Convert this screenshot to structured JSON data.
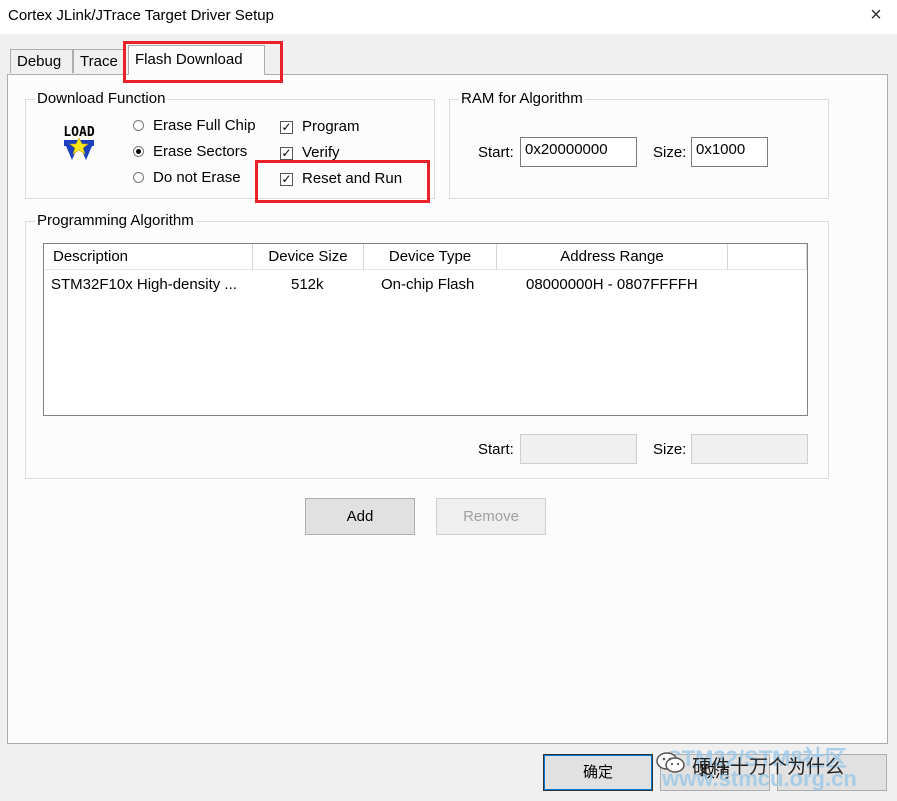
{
  "window": {
    "title": "Cortex JLink/JTrace Target Driver Setup",
    "close_glyph": "×"
  },
  "tabs": [
    {
      "label": "Debug"
    },
    {
      "label": "Trace"
    },
    {
      "label": "Flash Download",
      "selected": true
    }
  ],
  "download_function": {
    "label": "Download Function",
    "icon_text": "LOAD",
    "erase_options": [
      {
        "label": "Erase Full Chip",
        "selected": false
      },
      {
        "label": "Erase Sectors",
        "selected": true
      },
      {
        "label": "Do not Erase",
        "selected": false
      }
    ],
    "checks": [
      {
        "label": "Program",
        "checked": true
      },
      {
        "label": "Verify",
        "checked": true
      },
      {
        "label": "Reset and Run",
        "checked": true
      }
    ]
  },
  "ram_for_algorithm": {
    "label": "RAM for Algorithm",
    "start_label": "Start:",
    "start_value": "0x20000000",
    "size_label": "Size:",
    "size_value": "0x1000"
  },
  "programming_algorithm": {
    "label": "Programming Algorithm",
    "columns": [
      "Description",
      "Device Size",
      "Device Type",
      "Address Range"
    ],
    "rows": [
      [
        "STM32F10x High-density ...",
        "512k",
        "On-chip Flash",
        "08000000H - 0807FFFFH"
      ]
    ],
    "start_label": "Start:",
    "start_value": "",
    "size_label": "Size:",
    "size_value": ""
  },
  "buttons": {
    "add": "Add",
    "remove": "Remove",
    "ok": "确定",
    "cancel": "取消"
  },
  "watermark": {
    "line1": "STM32/STM8社区",
    "line2": "硬件十万个为什么",
    "line3": "www.stmcu.org.cn"
  },
  "colors": {
    "highlight": "#e8212b",
    "selection": "#0078d7"
  }
}
